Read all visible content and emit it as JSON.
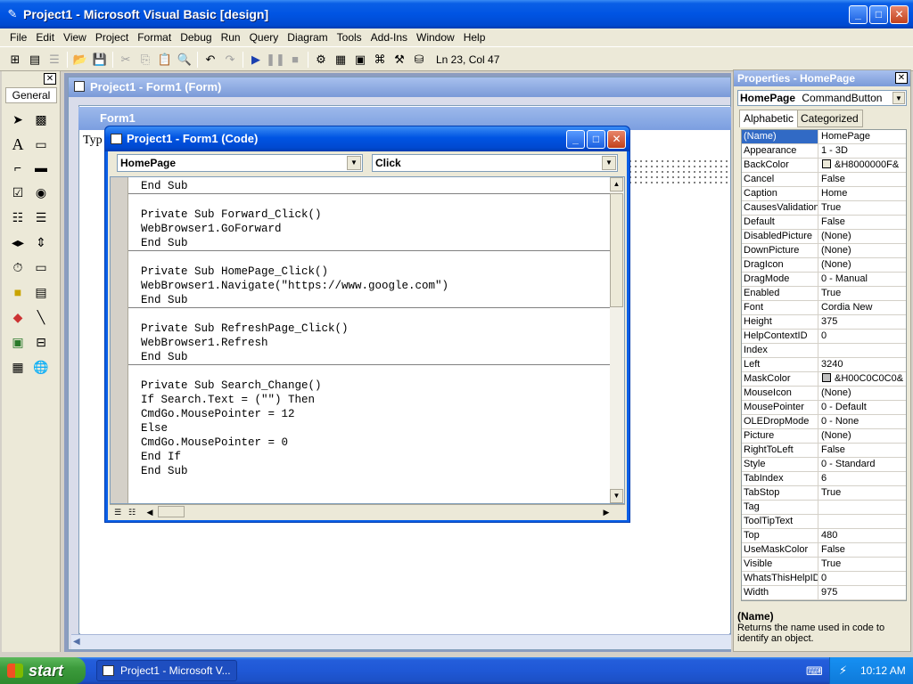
{
  "window": {
    "title": "Project1 - Microsoft Visual Basic [design]",
    "icon": "vb-icon"
  },
  "menubar": {
    "items": [
      "File",
      "Edit",
      "View",
      "Project",
      "Format",
      "Debug",
      "Run",
      "Query",
      "Diagram",
      "Tools",
      "Add-Ins",
      "Window",
      "Help"
    ]
  },
  "toolbar": {
    "position_readout": "Ln 23, Col 47"
  },
  "toolbox": {
    "tab_label": "General"
  },
  "form_window": {
    "title": "Project1 - Form1 (Form)",
    "form_caption": "Form1",
    "text_fragment": "Typ"
  },
  "code_window": {
    "title": "Project1 - Form1 (Code)",
    "object_combo": "HomePage",
    "procedure_combo": "Click",
    "lines": [
      "End Sub",
      "",
      "Private Sub Forward_Click()",
      "WebBrowser1.GoForward",
      "End Sub",
      "",
      "Private Sub HomePage_Click()",
      "WebBrowser1.Navigate(\"https://www.google.com\")",
      "End Sub",
      "",
      "Private Sub RefreshPage_Click()",
      "WebBrowser1.Refresh",
      "End Sub",
      "",
      "Private Sub Search_Change()",
      "If Search.Text = (\"\") Then",
      "CmdGo.MousePointer = 12",
      "Else",
      "CmdGo.MousePointer = 0",
      "End If",
      "End Sub"
    ]
  },
  "properties": {
    "title": "Properties - HomePage",
    "object_name": "HomePage",
    "object_type": "CommandButton",
    "tabs": [
      "Alphabetic",
      "Categorized"
    ],
    "rows": [
      {
        "name": "(Name)",
        "value": "HomePage"
      },
      {
        "name": "Appearance",
        "value": "1 - 3D"
      },
      {
        "name": "BackColor",
        "value": "&H8000000F&",
        "swatch": "#ece9d8"
      },
      {
        "name": "Cancel",
        "value": "False"
      },
      {
        "name": "Caption",
        "value": "Home"
      },
      {
        "name": "CausesValidation",
        "value": "True"
      },
      {
        "name": "Default",
        "value": "False"
      },
      {
        "name": "DisabledPicture",
        "value": "(None)"
      },
      {
        "name": "DownPicture",
        "value": "(None)"
      },
      {
        "name": "DragIcon",
        "value": "(None)"
      },
      {
        "name": "DragMode",
        "value": "0 - Manual"
      },
      {
        "name": "Enabled",
        "value": "True"
      },
      {
        "name": "Font",
        "value": "Cordia New"
      },
      {
        "name": "Height",
        "value": "375"
      },
      {
        "name": "HelpContextID",
        "value": "0"
      },
      {
        "name": "Index",
        "value": ""
      },
      {
        "name": "Left",
        "value": "3240"
      },
      {
        "name": "MaskColor",
        "value": "&H00C0C0C0&",
        "swatch": "#c0c0c0"
      },
      {
        "name": "MouseIcon",
        "value": "(None)"
      },
      {
        "name": "MousePointer",
        "value": "0 - Default"
      },
      {
        "name": "OLEDropMode",
        "value": "0 - None"
      },
      {
        "name": "Picture",
        "value": "(None)"
      },
      {
        "name": "RightToLeft",
        "value": "False"
      },
      {
        "name": "Style",
        "value": "0 - Standard"
      },
      {
        "name": "TabIndex",
        "value": "6"
      },
      {
        "name": "TabStop",
        "value": "True"
      },
      {
        "name": "Tag",
        "value": ""
      },
      {
        "name": "ToolTipText",
        "value": ""
      },
      {
        "name": "Top",
        "value": "480"
      },
      {
        "name": "UseMaskColor",
        "value": "False"
      },
      {
        "name": "Visible",
        "value": "True"
      },
      {
        "name": "WhatsThisHelpID",
        "value": "0"
      },
      {
        "name": "Width",
        "value": "975"
      }
    ],
    "description_title": "(Name)",
    "description_text": "Returns the name used in code to identify an object."
  },
  "taskbar": {
    "start_label": "start",
    "task_item": "Project1 - Microsoft V...",
    "clock": "10:12 AM"
  },
  "colors": {
    "title_blue": "#0054e3",
    "selection": "#316ac5",
    "start_green": "#3c9b3c"
  }
}
